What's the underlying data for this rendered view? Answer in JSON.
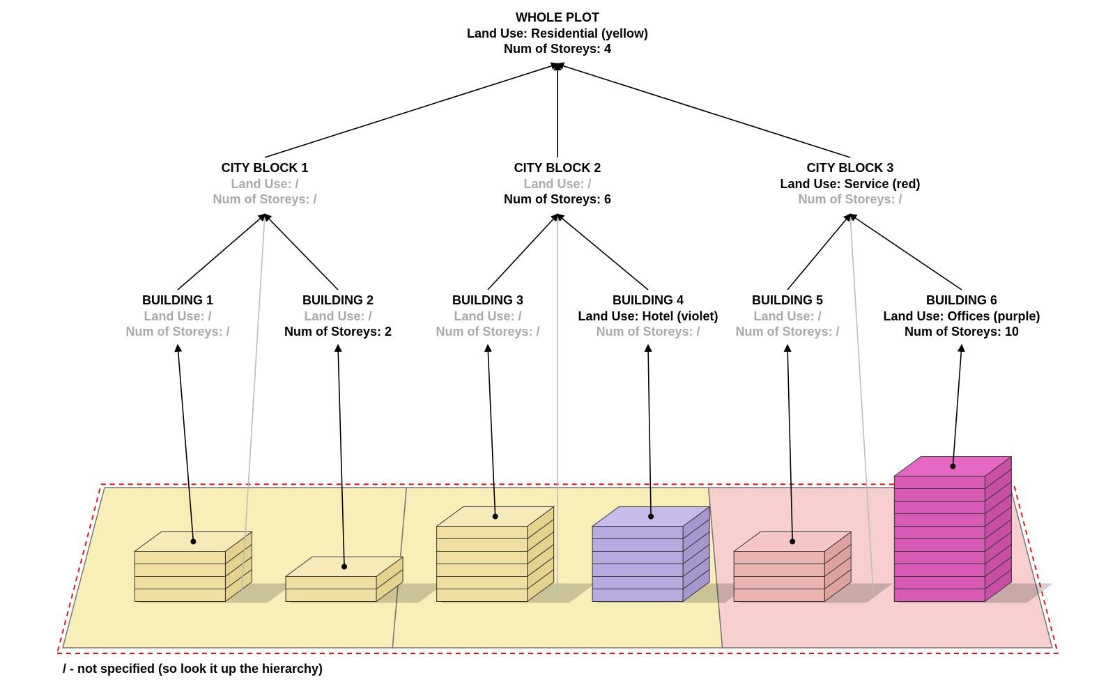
{
  "hierarchy": {
    "root": {
      "title": "WHOLE PLOT",
      "land_use": "Land Use: Residential (yellow)",
      "storeys": "Num of Storeys: 4",
      "land_use_specified": true,
      "storeys_specified": true
    },
    "blocks": [
      {
        "id": "block1",
        "title": "CITY BLOCK 1",
        "land_use": "Land Use: /",
        "storeys": "Num of Storeys: /",
        "land_use_specified": false,
        "storeys_specified": false
      },
      {
        "id": "block2",
        "title": "CITY BLOCK 2",
        "land_use": "Land Use: /",
        "storeys": "Num of Storeys: 6",
        "land_use_specified": false,
        "storeys_specified": true
      },
      {
        "id": "block3",
        "title": "CITY BLOCK 3",
        "land_use": "Land Use: Service (red)",
        "storeys": "Num of Storeys: /",
        "land_use_specified": true,
        "storeys_specified": false
      }
    ],
    "buildings": [
      {
        "id": "b1",
        "title": "BUILDING 1",
        "land_use": "Land Use: /",
        "storeys_label": "Num of Storeys: /",
        "land_use_specified": false,
        "storeys_specified": false,
        "storeys": 4,
        "color": "yellow"
      },
      {
        "id": "b2",
        "title": "BUILDING 2",
        "land_use": "Land Use: /",
        "storeys_label": "Num of Storeys: 2",
        "land_use_specified": false,
        "storeys_specified": true,
        "storeys": 2,
        "color": "yellow"
      },
      {
        "id": "b3",
        "title": "BUILDING 3",
        "land_use": "Land Use: /",
        "storeys_label": "Num of Storeys: /",
        "land_use_specified": false,
        "storeys_specified": false,
        "storeys": 6,
        "color": "yellow"
      },
      {
        "id": "b4",
        "title": "BUILDING 4",
        "land_use": "Land Use: Hotel (violet)",
        "storeys_label": "Num of Storeys: /",
        "land_use_specified": true,
        "storeys_specified": false,
        "storeys": 6,
        "color": "violet"
      },
      {
        "id": "b5",
        "title": "BUILDING 5",
        "land_use": "Land Use: /",
        "storeys_label": "Num of Storeys: /",
        "land_use_specified": false,
        "storeys_specified": false,
        "storeys": 4,
        "color": "red"
      },
      {
        "id": "b6",
        "title": "BUILDING 6",
        "land_use": "Land Use: Offices (purple)",
        "storeys_label": "Num of Storeys: 10",
        "land_use_specified": true,
        "storeys_specified": true,
        "storeys": 10,
        "color": "purple"
      }
    ]
  },
  "palette": {
    "yellow": {
      "top": "#f6eab8",
      "front": "#efe0a1",
      "side": "#e4d38c",
      "ground": "#f7eeb8"
    },
    "violet": {
      "top": "#c6bbea",
      "front": "#b7aade",
      "side": "#a698ce",
      "ground": "#f7eeb8"
    },
    "red": {
      "top": "#f4c6c4",
      "front": "#eab4b1",
      "side": "#dea29f",
      "ground": "#f6cfce"
    },
    "purple": {
      "top": "#e667c3",
      "front": "#d95ab6",
      "side": "#c94ea6",
      "ground": "#f6cfce"
    }
  },
  "ground": {
    "blocks_fill": [
      "#f7eeb8",
      "#f7eeb8",
      "#f6cfce"
    ]
  },
  "footnote": "/ -  not specified (so look it up the hierarchy)"
}
